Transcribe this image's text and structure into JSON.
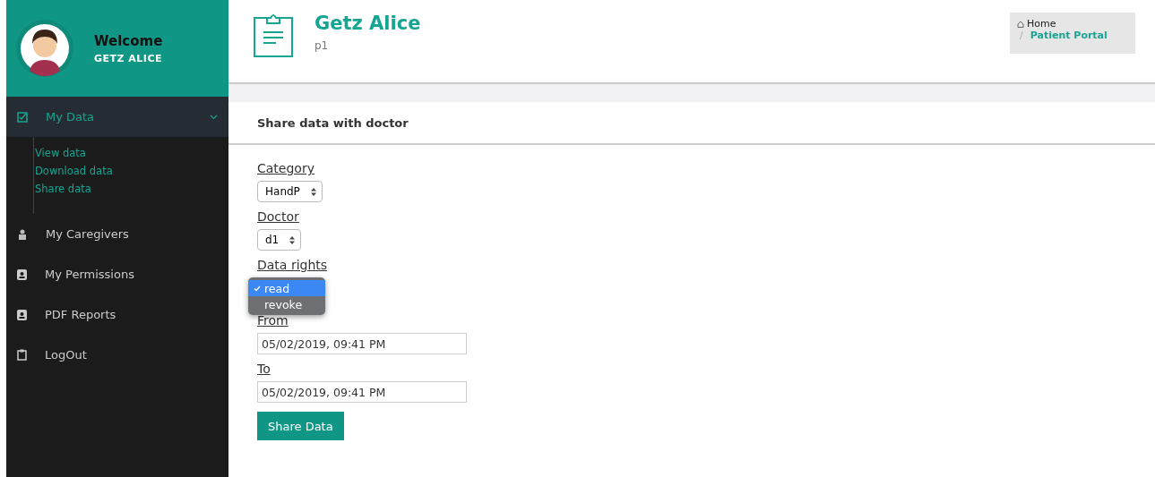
{
  "sidebar": {
    "welcome": "Welcome",
    "user": "GETZ ALICE",
    "items": [
      {
        "label": "My Data",
        "expanded": true,
        "children": [
          {
            "label": "View data"
          },
          {
            "label": "Download data"
          },
          {
            "label": "Share data"
          }
        ]
      },
      {
        "label": "My Caregivers",
        "expanded": false
      },
      {
        "label": "My Permissions",
        "expanded": false
      },
      {
        "label": "PDF Reports",
        "expanded": false
      },
      {
        "label": "LogOut",
        "expanded": false
      }
    ]
  },
  "header": {
    "title": "Getz Alice",
    "subtitle": "p1"
  },
  "breadcrumb": [
    "Home",
    "/",
    "Patient Portal"
  ],
  "panel": {
    "title": "Share data with doctor",
    "fields": [
      {
        "kind": "select",
        "label": "Category",
        "value": "HandP"
      },
      {
        "kind": "select",
        "label": "Doctor",
        "value": "d1"
      },
      {
        "kind": "menu",
        "label": "Data rights",
        "options": [
          {
            "label": "read",
            "selected": true
          },
          {
            "label": "revoke",
            "selected": false
          }
        ]
      },
      {
        "kind": "input",
        "label": "From",
        "value": "05/02/2019, 09:41 PM"
      },
      {
        "kind": "input",
        "label": "To",
        "value": "05/02/2019, 09:41 PM"
      }
    ],
    "button": "Share Data"
  }
}
